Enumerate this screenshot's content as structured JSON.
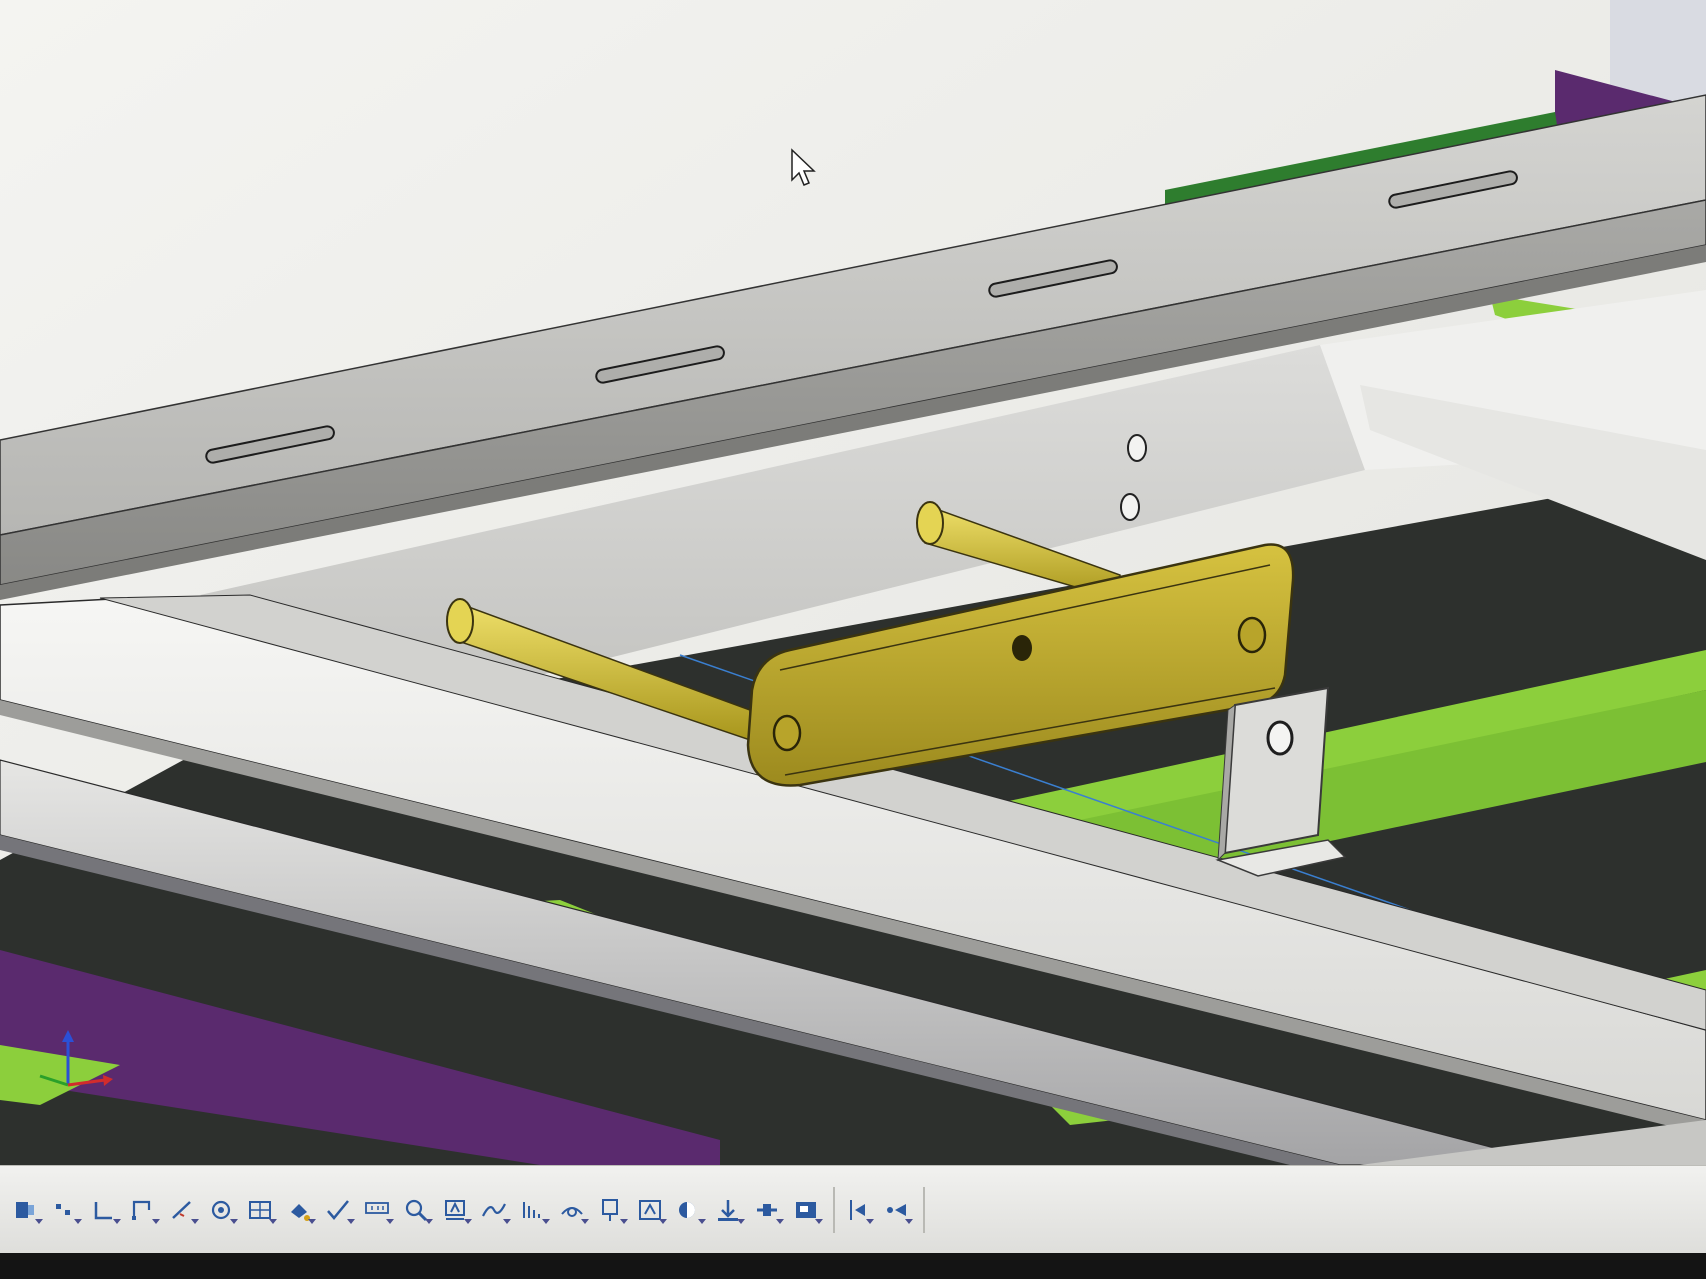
{
  "window": {
    "title": ""
  },
  "colors": {
    "background": "#eeeeea",
    "frame_steel": "#c8c8c4",
    "frame_dark": "#2d302d",
    "accent_green": "#8ccf3c",
    "dark_green": "#2e7d2e",
    "purple": "#5a2a6e",
    "bracket_yellow": "#c8b232",
    "toolbar_bg": "#e6e6e3",
    "toolbar_icon": "#2c5aa0"
  },
  "viewport": {
    "cursor": "arrow-cursor",
    "triad": {
      "x_axis_color": "#d12c2c",
      "y_axis_color": "#2aa02a",
      "z_axis_color": "#2b50d6"
    }
  },
  "toolbar": {
    "tools": [
      {
        "name": "edit-component-icon",
        "has_dropdown": true
      },
      {
        "name": "point-icon",
        "has_dropdown": true
      },
      {
        "name": "corner-box-icon",
        "has_dropdown": true
      },
      {
        "name": "polyline-icon",
        "has_dropdown": true
      },
      {
        "name": "line-icon",
        "has_dropdown": true
      },
      {
        "name": "target-icon",
        "has_dropdown": true
      },
      {
        "name": "smart-dimension-icon",
        "has_dropdown": true
      },
      {
        "name": "fill-icon",
        "has_dropdown": true
      },
      {
        "name": "checkmark-icon",
        "has_dropdown": true
      },
      {
        "name": "datum-icon",
        "has_dropdown": true
      },
      {
        "name": "zoom-icon",
        "has_dropdown": true
      },
      {
        "name": "annotation-icon",
        "has_dropdown": true
      },
      {
        "name": "curve-icon",
        "has_dropdown": true
      },
      {
        "name": "hatch-icon",
        "has_dropdown": true
      },
      {
        "name": "view-orient-icon",
        "has_dropdown": true
      },
      {
        "name": "section-view-icon",
        "has_dropdown": true
      },
      {
        "name": "block-icon",
        "has_dropdown": true
      },
      {
        "name": "display-style-icon",
        "has_dropdown": true
      },
      {
        "name": "insert-component-icon",
        "has_dropdown": true
      },
      {
        "name": "mate-icon",
        "has_dropdown": true
      },
      {
        "name": "assembly-icon",
        "has_dropdown": true
      },
      {
        "name": "flip-icon",
        "has_dropdown": true
      },
      {
        "name": "move-icon",
        "has_dropdown": true
      }
    ]
  }
}
